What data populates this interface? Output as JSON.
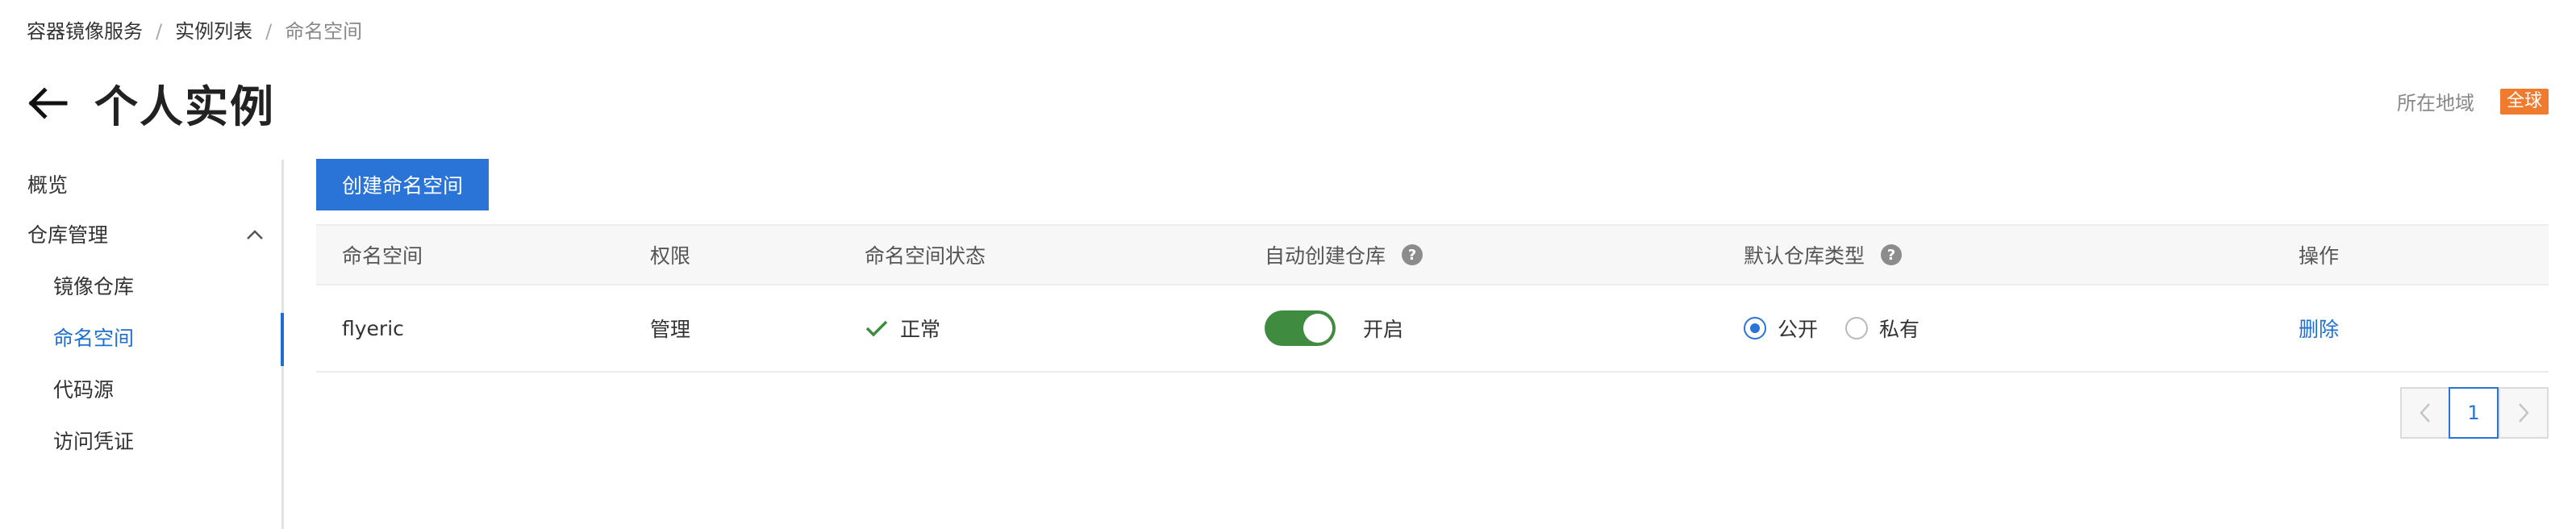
{
  "breadcrumb": {
    "items": [
      "容器镜像服务",
      "实例列表",
      "命名空间"
    ],
    "separator": "/"
  },
  "header": {
    "title": "个人实例",
    "back_icon": "arrow-left-icon",
    "region_label": "所在地域",
    "region_value": "全球",
    "region_color": "#f07a2e"
  },
  "sidebar": {
    "items": [
      {
        "label": "概览"
      },
      {
        "label": "仓库管理",
        "expanded": true
      },
      {
        "label": "镜像仓库"
      },
      {
        "label": "命名空间",
        "active": true
      },
      {
        "label": "代码源"
      },
      {
        "label": "访问凭证"
      }
    ]
  },
  "toolbar": {
    "create_label": "创建命名空间"
  },
  "table": {
    "columns": [
      "命名空间",
      "权限",
      "命名空间状态",
      "自动创建仓库",
      "默认仓库类型",
      "操作"
    ],
    "rows": [
      {
        "namespace": "flyeric",
        "permission": "管理",
        "status": "正常",
        "auto_create": "开启",
        "auto_create_on": true,
        "repo_type_options": [
          "公开",
          "私有"
        ],
        "repo_type_selected": "公开",
        "action": "删除"
      }
    ]
  },
  "pagination": {
    "current_page": "1"
  },
  "colors": {
    "primary": "#2a74d8",
    "success": "#3f8b3f",
    "link": "#1f6fd0"
  }
}
